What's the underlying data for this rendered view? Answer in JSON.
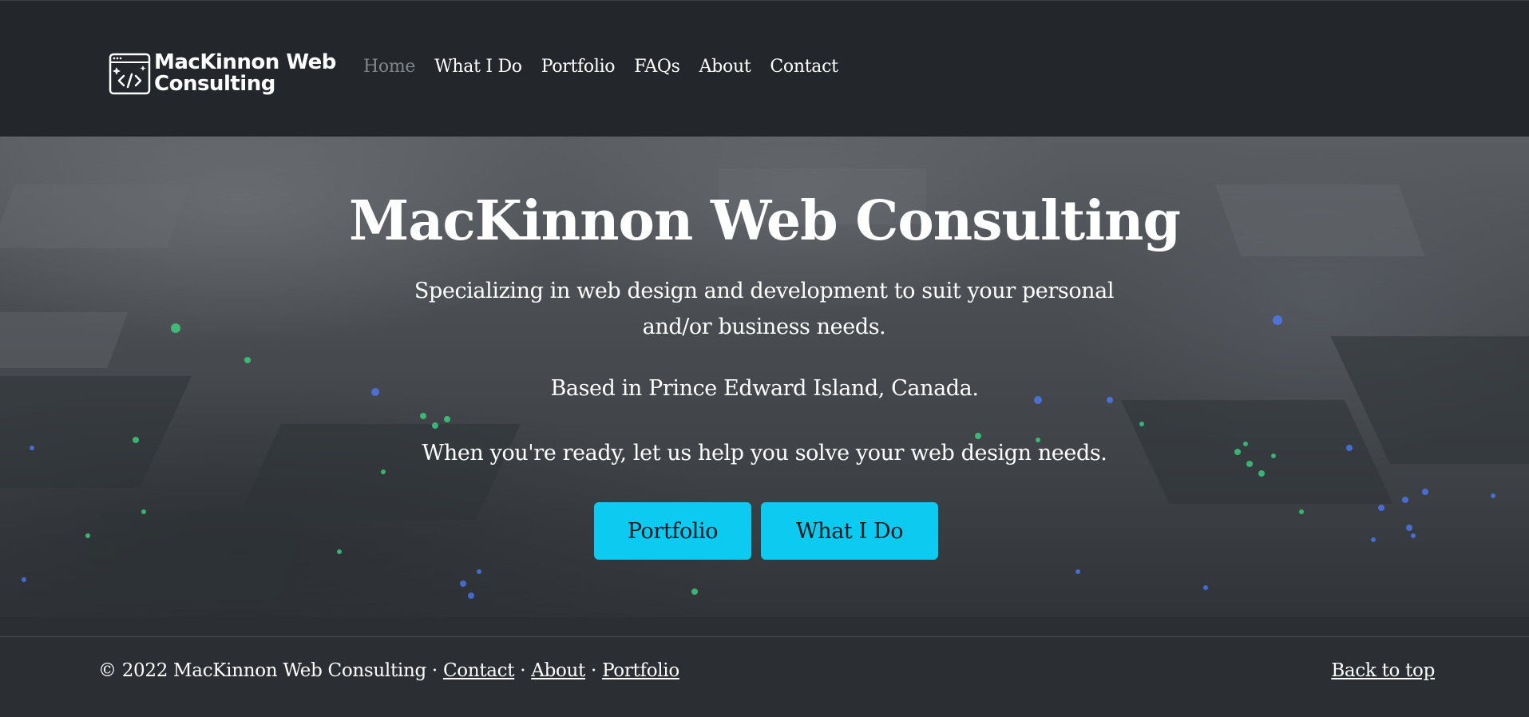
{
  "brand": {
    "line1": "MacKinnon Web",
    "line2": "Consulting",
    "logo_icon": "code-window-icon"
  },
  "nav": {
    "items": [
      {
        "label": "Home",
        "active": true
      },
      {
        "label": "What I Do",
        "active": false
      },
      {
        "label": "Portfolio",
        "active": false
      },
      {
        "label": "FAQs",
        "active": false
      },
      {
        "label": "About",
        "active": false
      },
      {
        "label": "Contact",
        "active": false
      }
    ]
  },
  "hero": {
    "title": "MacKinnon Web Consulting",
    "subtitle": "Specializing in web design and development to suit your personal and/or business needs.",
    "location": "Based in Prince Edward Island, Canada.",
    "cta_text": "When you're ready, let us help you solve your web design needs.",
    "buttons": {
      "portfolio": "Portfolio",
      "what_i_do": "What I Do"
    }
  },
  "footer": {
    "copyright": "© 2022 MacKinnon Web Consulting",
    "separator": " · ",
    "links": {
      "contact": "Contact",
      "about": "About",
      "portfolio": "Portfolio"
    },
    "back_to_top": "Back to top"
  },
  "colors": {
    "navbar_bg": "#23272b",
    "footer_bg": "#2b2f34",
    "button_bg": "#0dcaf0",
    "nav_active": "#7f868d"
  }
}
